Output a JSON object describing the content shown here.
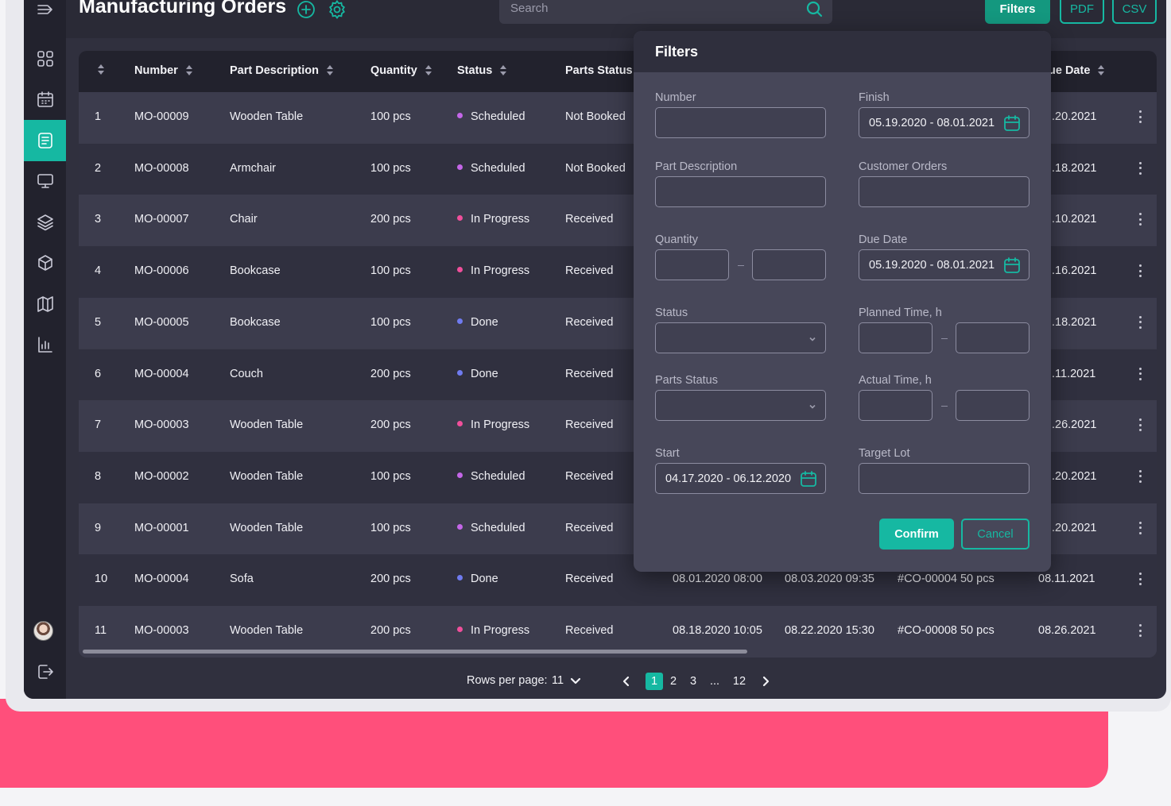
{
  "header": {
    "title": "Manufacturing Orders",
    "search_placeholder": "Search",
    "filters_label": "Filters",
    "pdf_label": "PDF",
    "csv_label": "CSV"
  },
  "sidebar": {
    "items": [
      {
        "icon": "menu-toggle-icon"
      },
      {
        "icon": "dashboard-grid-icon"
      },
      {
        "icon": "calendar-icon"
      },
      {
        "icon": "orders-document-icon",
        "active": true
      },
      {
        "icon": "monitor-icon"
      },
      {
        "icon": "layers-icon"
      },
      {
        "icon": "cube-icon"
      },
      {
        "icon": "map-icon"
      },
      {
        "icon": "chart-report-icon"
      }
    ],
    "logout_icon": "logout-icon"
  },
  "table": {
    "columns": [
      "",
      "Number",
      "Part Description",
      "Quantity",
      "Status",
      "Parts Status",
      "ue Date"
    ],
    "rows": [
      {
        "idx": "1",
        "number": "MO-00009",
        "part": "Wooden Table",
        "qty": "100 pcs",
        "status": "Scheduled",
        "status_color": "#c466e8",
        "parts": "Not Booked",
        "start": "",
        "finish": "",
        "orders": "",
        "due": ".20.2021"
      },
      {
        "idx": "2",
        "number": "MO-00008",
        "part": "Armchair",
        "qty": "100 pcs",
        "status": "Scheduled",
        "status_color": "#c466e8",
        "parts": "Not Booked",
        "start": "",
        "finish": "",
        "orders": "",
        "due": ".18.2021"
      },
      {
        "idx": "3",
        "number": "MO-00007",
        "part": "Chair",
        "qty": "200 pcs",
        "status": "In Progress",
        "status_color": "#f04f9b",
        "parts": "Received",
        "start": "",
        "finish": "",
        "orders": "",
        "due": ".10.2021"
      },
      {
        "idx": "4",
        "number": "MO-00006",
        "part": "Bookcase",
        "qty": "100 pcs",
        "status": "In Progress",
        "status_color": "#f04f9b",
        "parts": "Received",
        "start": "",
        "finish": "",
        "orders": "",
        "due": ".16.2021"
      },
      {
        "idx": "5",
        "number": "MO-00005",
        "part": "Bookcase",
        "qty": "100 pcs",
        "status": "Done",
        "status_color": "#6f7bf0",
        "parts": "Received",
        "start": "",
        "finish": "",
        "orders": "",
        "due": ".18.2021"
      },
      {
        "idx": "6",
        "number": "MO-00004",
        "part": "Couch",
        "qty": "200 pcs",
        "status": "Done",
        "status_color": "#6f7bf0",
        "parts": "Received",
        "start": "",
        "finish": "",
        "orders": "",
        "due": ".11.2021"
      },
      {
        "idx": "7",
        "number": "MO-00003",
        "part": "Wooden Table",
        "qty": "200 pcs",
        "status": "In Progress",
        "status_color": "#f04f9b",
        "parts": "Received",
        "start": "",
        "finish": "",
        "orders": "",
        "due": ".26.2021"
      },
      {
        "idx": "8",
        "number": "MO-00002",
        "part": "Wooden Table",
        "qty": "100 pcs",
        "status": "Scheduled",
        "status_color": "#c466e8",
        "parts": "Received",
        "start": "",
        "finish": "",
        "orders": "",
        "due": ".20.2021"
      },
      {
        "idx": "9",
        "number": "MO-00001",
        "part": "Wooden Table",
        "qty": "100 pcs",
        "status": "Scheduled",
        "status_color": "#c466e8",
        "parts": "Received",
        "start": "",
        "finish": "",
        "orders": "",
        "due": ".20.2021"
      },
      {
        "idx": "10",
        "number": "MO-00004",
        "part": "Sofa",
        "qty": "200 pcs",
        "status": "Done",
        "status_color": "#6f7bf0",
        "parts": "Received",
        "start": "08.01.2020 08:00",
        "finish": "08.03.2020 09:35",
        "orders": "#CO-00004 50 pcs",
        "due": "08.11.2021"
      },
      {
        "idx": "11",
        "number": "MO-00003",
        "part": "Wooden Table",
        "qty": "200 pcs",
        "status": "In Progress",
        "status_color": "#f04f9b",
        "parts": "Received",
        "start": "08.18.2020 10:05",
        "finish": "08.22.2020 15:30",
        "orders": "#CO-00008 50 pcs",
        "due": "08.26.2021"
      }
    ]
  },
  "pagination": {
    "rows_per_page_label": "Rows per page:",
    "rows_per_page_value": "11",
    "pages": [
      "1",
      "2",
      "3",
      "...",
      "12"
    ],
    "current_page": "1"
  },
  "filters": {
    "title": "Filters",
    "number_label": "Number",
    "finish_label": "Finish",
    "finish_value": "05.19.2020 - 08.01.2021",
    "part_description_label": "Part Description",
    "customer_orders_label": "Customer Orders",
    "quantity_label": "Quantity",
    "due_date_label": "Due Date",
    "due_date_value": "05.19.2020 - 08.01.2021",
    "status_label": "Status",
    "planned_time_label": "Planned Time, h",
    "parts_status_label": "Parts Status",
    "actual_time_label": "Actual Time, h",
    "start_label": "Start",
    "start_value": "04.17.2020 - 06.12.2020",
    "target_lot_label": "Target Lot",
    "confirm_label": "Confirm",
    "cancel_label": "Cancel"
  },
  "colors": {
    "accent": "#16b8a2",
    "background": "#30303e",
    "status_scheduled": "#c466e8",
    "status_in_progress": "#f04f9b",
    "status_done": "#6f7bf0"
  }
}
